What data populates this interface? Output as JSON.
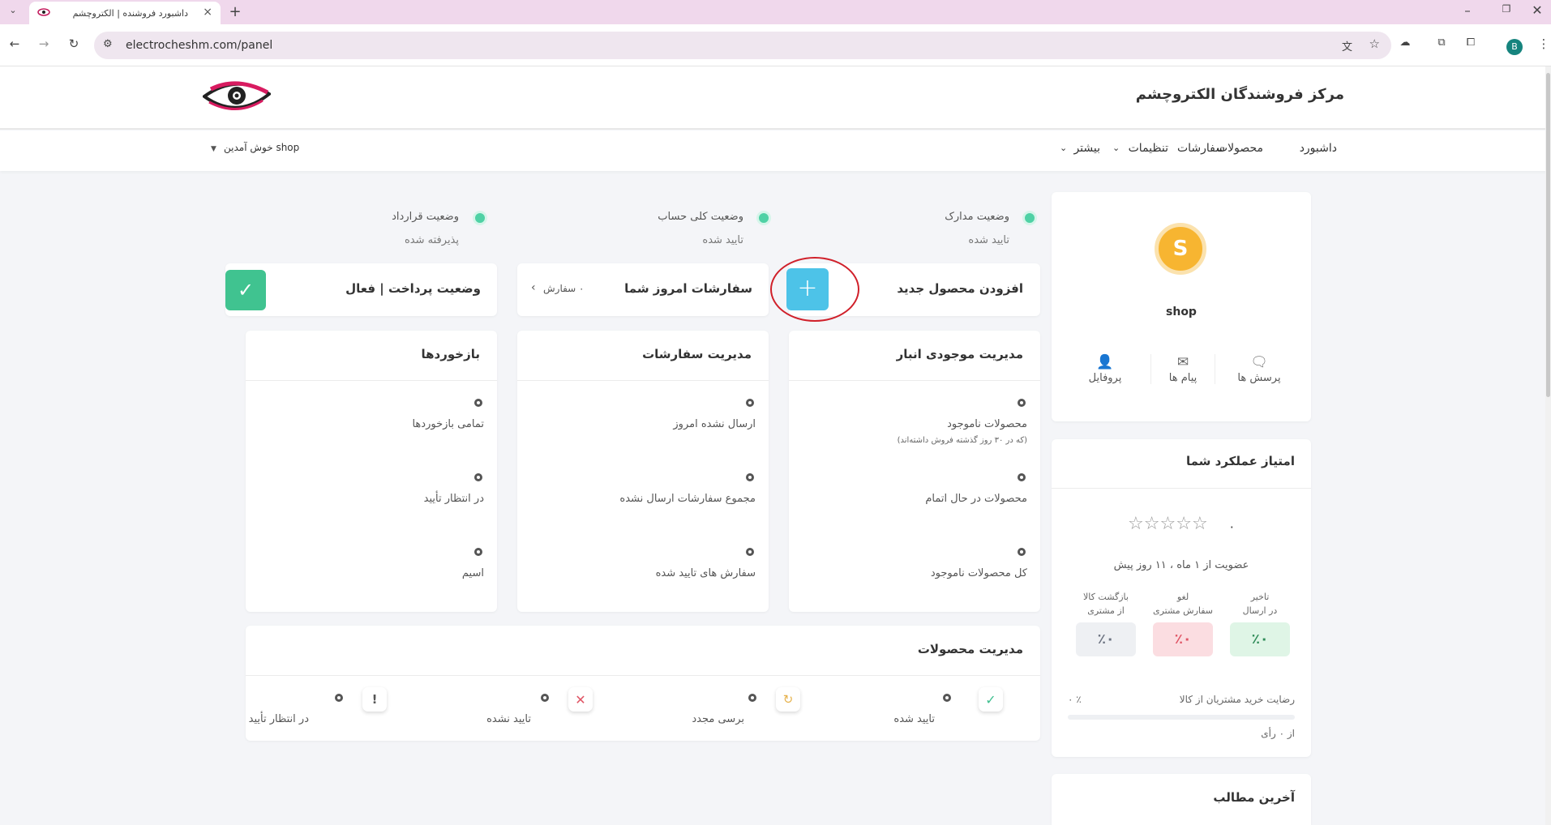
{
  "browser": {
    "tab_title": "داشبورد فروشنده | الکتروچشم",
    "url": "electrocheshm.com/panel",
    "profile_initial": "B"
  },
  "site": {
    "name": "مرکز فروشندگان الکتروچشم",
    "nav": [
      "داشبورد",
      "محصولات",
      "سفارشات",
      "تنظیمات",
      "بیشتر"
    ],
    "welcome": "shop خوش آمدین"
  },
  "status": {
    "docs": {
      "title": "وضعیت مدارک",
      "value": "تایید شده"
    },
    "account": {
      "title": "وضعیت کلی حساب",
      "value": "تایید شده"
    },
    "contract": {
      "title": "وضعیت قرارداد",
      "value": "پذیرفته شده"
    }
  },
  "quick": {
    "add_product": "افزودن محصول جدید",
    "today_orders": "سفارشات امروز شما",
    "today_orders_count": "۰ سفارش",
    "payment_status": "وضعیت پرداخت | فعال"
  },
  "inventory": {
    "title": "مدیریت موجودی انبار",
    "items": [
      "محصولات ناموجود",
      "محصولات در حال اتمام",
      "کل محصولات ناموجود"
    ],
    "note": "(که در ۳۰ روز گذشته فروش داشته‌اند)"
  },
  "orders": {
    "title": "مدیریت سفارشات",
    "items": [
      "ارسال نشده امروز",
      "مجموع سفارشات ارسال نشده",
      "سفارش های تایید شده"
    ]
  },
  "feedback": {
    "title": "بازخوردها",
    "items": [
      "تمامی بازخوردها",
      "در انتظار تأیید",
      "اسیم"
    ]
  },
  "products": {
    "title": "مدیریت محصولات",
    "items": [
      "تایید شده",
      "برسی مجدد",
      "تایید نشده",
      "در انتظار تأیید"
    ],
    "counts": [
      "0",
      "0",
      "0",
      "0"
    ]
  },
  "profile": {
    "avatar_letter": "S",
    "name": "shop",
    "links": [
      "پرسش ها",
      "پیام ها",
      "پروفایل"
    ]
  },
  "performance": {
    "title": "امتیاز عملکرد شما",
    "rating": "۰",
    "rating_stars": 0,
    "membership": "عضویت از ۱ ماه ، ۱۱ روز پیش",
    "metrics": [
      {
        "label1": "تاخیر",
        "label2": "در ارسال",
        "value": "٪۰",
        "color": "#2e8b57"
      },
      {
        "label1": "لغو",
        "label2": "سفارش مشتری",
        "value": "٪۰",
        "color": "#e05565"
      },
      {
        "label1": "بازگشت کالا",
        "label2": "از مشتری",
        "value": "٪۰",
        "color": "#6b7280"
      }
    ],
    "satisfaction": "رضایت خرید مشتریان از کالا",
    "satisfaction_value": "٪ ۰",
    "votes": "از ۰ رأی"
  },
  "latest": {
    "title": "آخرین مطالب"
  }
}
